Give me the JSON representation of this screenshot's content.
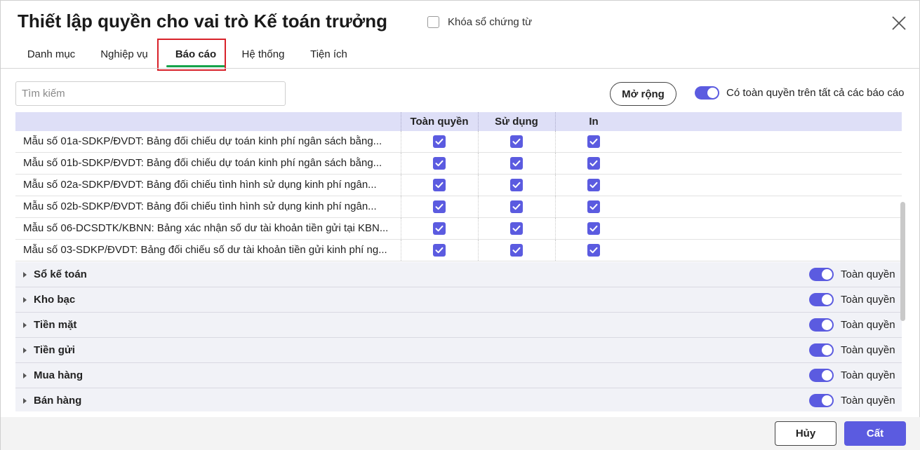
{
  "dialog": {
    "title": "Thiết lập quyền cho vai trò Kế toán trưởng",
    "lock_label": "Khóa sổ chứng từ",
    "lock_checked": false
  },
  "tabs": [
    {
      "label": "Danh mục",
      "active": false
    },
    {
      "label": "Nghiệp vụ",
      "active": false
    },
    {
      "label": "Báo cáo",
      "active": true
    },
    {
      "label": "Hệ thống",
      "active": false
    },
    {
      "label": "Tiện ích",
      "active": false
    }
  ],
  "toolbar": {
    "search_placeholder": "Tìm kiếm",
    "search_value": "",
    "expand_label": "Mở rộng",
    "all_reports_label": "Có toàn quyền trên tất cả các báo cáo",
    "all_reports_on": true
  },
  "table": {
    "columns": [
      "Toàn quyền",
      "Sử dụng",
      "In"
    ],
    "rows": [
      {
        "name": "Mẫu số 01a-SDKP/ĐVDT: Bảng đối chiếu dự toán kinh phí ngân sách bằng...",
        "full": true,
        "use": true,
        "print": true
      },
      {
        "name": "Mẫu số 01b-SDKP/ĐVDT: Bảng đối chiếu dự toán kinh phí ngân sách bằng...",
        "full": true,
        "use": true,
        "print": true
      },
      {
        "name": "Mẫu số 02a-SDKP/ĐVDT: Bảng đối chiếu tình hình sử dụng kinh phí ngân...",
        "full": true,
        "use": true,
        "print": true
      },
      {
        "name": "Mẫu số 02b-SDKP/ĐVDT: Bảng đối chiếu tình hình sử dụng kinh phí ngân...",
        "full": true,
        "use": true,
        "print": true
      },
      {
        "name": "Mẫu số 06-DCSDTK/KBNN: Bảng xác nhận số dư tài khoản tiền gửi tại KBN...",
        "full": true,
        "use": true,
        "print": true
      },
      {
        "name": "Mẫu số 03-SDKP/ĐVDT: Bảng đối chiếu số dư tài khoản tiền gửi kinh phí ng...",
        "full": true,
        "use": true,
        "print": true
      }
    ],
    "groups": [
      {
        "name": "Sổ kế toán",
        "toggle_label": "Toàn quyền",
        "on": true
      },
      {
        "name": "Kho bạc",
        "toggle_label": "Toàn quyền",
        "on": true
      },
      {
        "name": "Tiền mặt",
        "toggle_label": "Toàn quyền",
        "on": true
      },
      {
        "name": "Tiền gửi",
        "toggle_label": "Toàn quyền",
        "on": true
      },
      {
        "name": "Mua hàng",
        "toggle_label": "Toàn quyền",
        "on": true
      },
      {
        "name": "Bán hàng",
        "toggle_label": "Toàn quyền",
        "on": true
      }
    ]
  },
  "footer": {
    "cancel_label": "Hủy",
    "save_label": "Cất"
  },
  "colors": {
    "accent": "#5b5be0",
    "tab_underline": "#16a34a",
    "highlight_outline": "#d8222a",
    "header_bg": "#dedff7"
  }
}
